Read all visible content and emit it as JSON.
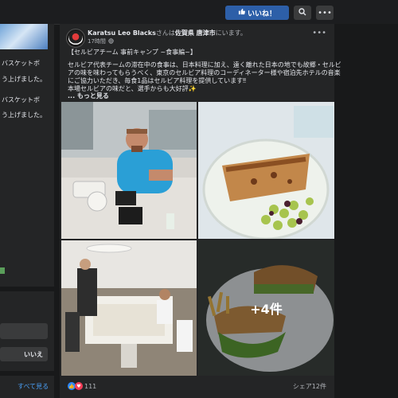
{
  "topbar": {
    "like_label": "いいね！",
    "like_icon": "thumbs-up-icon",
    "search_icon": "search-icon",
    "more_icon": "more-icon"
  },
  "left": {
    "lines": [
      "バスケットボ",
      "う上げました。",
      "バスケットボ",
      "う上げました。"
    ],
    "no_button": "いいえ",
    "see_all": "すべて見る"
  },
  "post": {
    "author": "Karatsu Leo Blacks",
    "author_suffix": "さんは",
    "place": "佐賀県 唐津市",
    "place_suffix": "にいます。",
    "time": "17時間",
    "privacy_icon": "globe-icon",
    "lines": [
      "【セルビアチーム 事前キャンプ ~食事編~】",
      "セルビア代表チームの滞在中の食事は、日本料理に加え、遠く離れた日本の地でも故郷・セルビ",
      "アの味を味わってもらうべく、東京のセルビア料理のコーディネーター様や宿泊先ホテルの音楽",
      "にご協力いただき、毎食1品はセルビア料理を提供しています‼",
      "本場セルビアの味だと、選手からも大好評✨"
    ],
    "see_more": "... もっと見る",
    "more_photos": "+4件"
  },
  "footer": {
    "reactions": "111",
    "shares": "シェア12件"
  },
  "colors": {
    "background": "#18191a",
    "card": "#242526",
    "accent": "#2d5fa8",
    "link": "#4a9ff5"
  }
}
